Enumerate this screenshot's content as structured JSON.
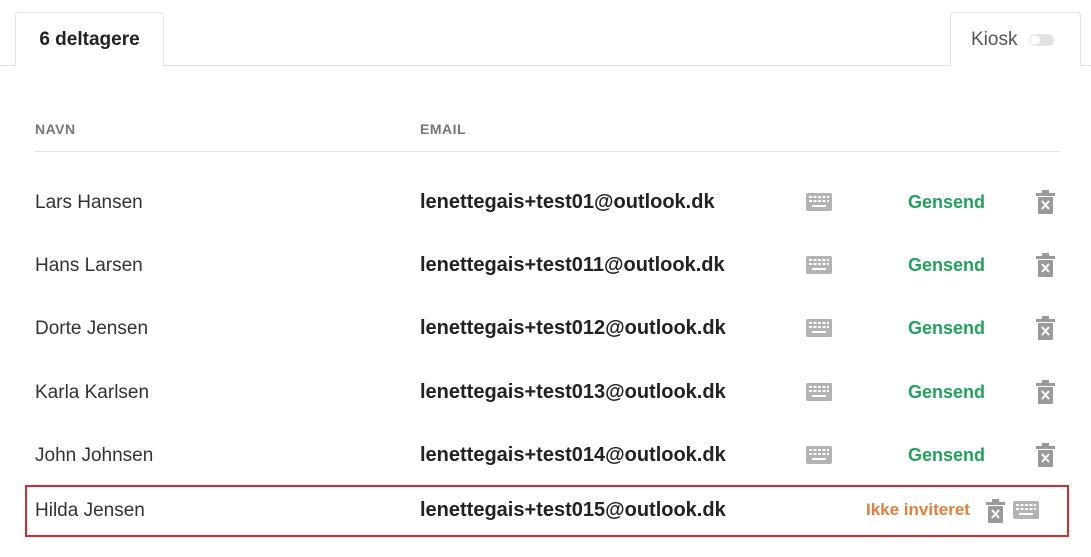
{
  "tabs": {
    "active_label": "6  deltagere",
    "kiosk_label": "Kiosk",
    "kiosk_enabled": false
  },
  "table": {
    "headers": {
      "name": "NAVN",
      "email": "EMAIL"
    },
    "rows": [
      {
        "name": "Lars Hansen",
        "email": "lenettegais+test01@outlook.dk",
        "action": "Gensend"
      },
      {
        "name": "Hans Larsen",
        "email": "lenettegais+test011@outlook.dk",
        "action": "Gensend"
      },
      {
        "name": "Dorte Jensen",
        "email": "lenettegais+test012@outlook.dk",
        "action": "Gensend"
      },
      {
        "name": "Karla Karlsen",
        "email": "lenettegais+test013@outlook.dk",
        "action": "Gensend"
      },
      {
        "name": "John Johnsen",
        "email": "lenettegais+test014@outlook.dk",
        "action": "Gensend"
      },
      {
        "name": "Hilda Jensen",
        "email": "lenettegais+test015@outlook.dk",
        "status": "Ikke inviteret"
      }
    ]
  },
  "colors": {
    "resend": "#1fa35a",
    "not_invited": "#e67d3c",
    "highlight_border": "#d62b2b",
    "icon_gray": "#aaaaaa"
  },
  "icons": {
    "keyboard": "keyboard-icon",
    "delete": "trash-icon"
  }
}
